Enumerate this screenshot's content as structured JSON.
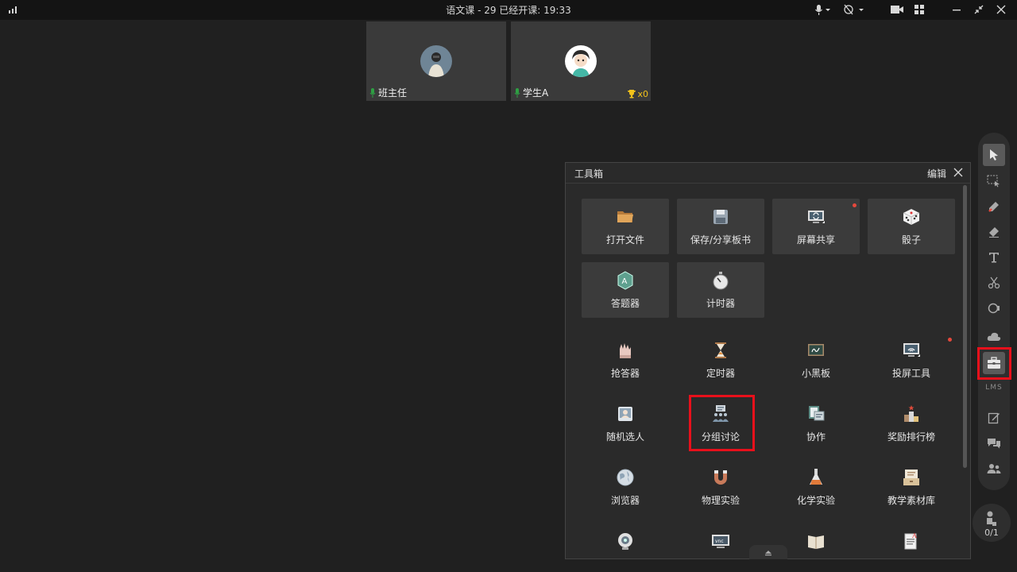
{
  "titlebar": {
    "title": "语文课 - 29   已经开课: 19:33"
  },
  "videos": [
    {
      "name": "班主任"
    },
    {
      "name": "学生A",
      "trophy_count": "x0"
    }
  ],
  "toolbox": {
    "title": "工具箱",
    "edit_label": "编辑",
    "cards": [
      {
        "label": "打开文件",
        "icon": "folder-icon"
      },
      {
        "label": "保存/分享板书",
        "icon": "save-icon"
      },
      {
        "label": "屏幕共享",
        "icon": "screen-share-icon"
      },
      {
        "label": "骰子",
        "icon": "dice-icon"
      },
      {
        "label": "答题器",
        "icon": "answer-icon"
      },
      {
        "label": "计时器",
        "icon": "stopwatch-icon"
      }
    ],
    "tools": [
      {
        "label": "抢答器",
        "icon": "raise-hands-icon"
      },
      {
        "label": "定时器",
        "icon": "hourglass-icon"
      },
      {
        "label": "小黑板",
        "icon": "blackboard-icon"
      },
      {
        "label": "投屏工具",
        "icon": "cast-icon"
      },
      {
        "label": "随机选人",
        "icon": "random-person-icon"
      },
      {
        "label": "分组讨论",
        "icon": "group-discussion-icon"
      },
      {
        "label": "协作",
        "icon": "collaborate-icon"
      },
      {
        "label": "奖励排行榜",
        "icon": "leaderboard-icon"
      },
      {
        "label": "浏览器",
        "icon": "browser-icon"
      },
      {
        "label": "物理实验",
        "icon": "magnet-icon"
      },
      {
        "label": "化学实验",
        "icon": "flask-icon"
      },
      {
        "label": "教学素材库",
        "icon": "material-library-icon"
      }
    ],
    "partial_row_icons": [
      "webcam-icon",
      "vnc-icon",
      "book-icon",
      "document-icon"
    ]
  },
  "sidebar": {
    "lms_label": "LMS",
    "hand_count": "0/1"
  },
  "colors": {
    "highlight": "#e8101b",
    "mic_green": "#2ea043",
    "badge_red": "#e5483c",
    "trophy_yellow": "#f2c21a"
  }
}
